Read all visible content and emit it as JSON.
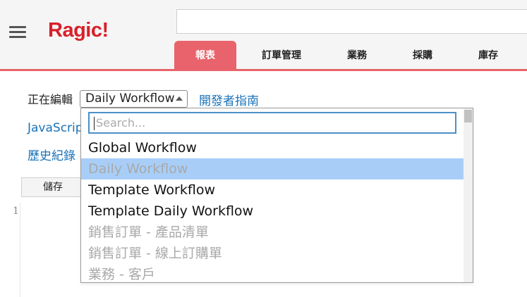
{
  "app": {
    "logo": "Ragic!"
  },
  "nav": {
    "tabs": [
      {
        "label": "報表"
      },
      {
        "label": "訂單管理"
      },
      {
        "label": "業務"
      },
      {
        "label": "採購"
      },
      {
        "label": "庫存"
      }
    ]
  },
  "editor": {
    "editing_label": "正在編輯",
    "selected_script": "Daily Workflow",
    "dev_guide_link": "開發者指南",
    "javascript_link": "JavaScript",
    "history_link": "歷史紀錄",
    "save_label": "儲存",
    "line_numbers": [
      "1"
    ]
  },
  "dropdown": {
    "search_placeholder": "Search...",
    "options": [
      {
        "label": "Global Workflow",
        "state": "enabled"
      },
      {
        "label": "Daily Workflow",
        "state": "selected"
      },
      {
        "label": "Template Workflow",
        "state": "enabled"
      },
      {
        "label": "Template Daily Workflow",
        "state": "enabled"
      },
      {
        "label": "銷售訂單 - 產品清單",
        "state": "disabled"
      },
      {
        "label": "銷售訂單 - 線上訂購單",
        "state": "disabled"
      },
      {
        "label": "業務 - 客戶",
        "state": "disabled"
      }
    ]
  },
  "colors": {
    "accent": "#e8636b",
    "logo": "#d8202a",
    "link": "#1a73b8",
    "highlight": "#a8cef8"
  }
}
